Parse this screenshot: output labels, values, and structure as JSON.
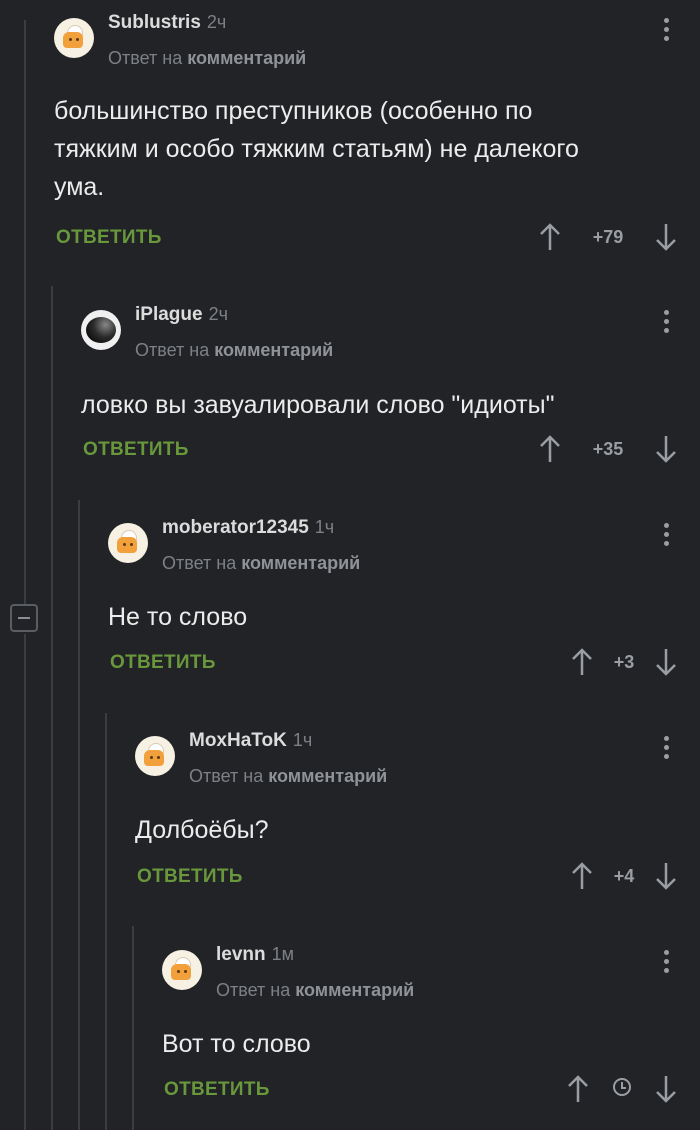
{
  "comments": [
    {
      "username": "Sublustris",
      "time": "2ч",
      "reply_prefix": "Ответ на",
      "reply_link": "комментарий",
      "text": "большинство преступников (особенно по тяжким и особо тяжким статьям) не далекого ума.",
      "reply_label": "ОТВЕТИТЬ",
      "score": "+79",
      "avatar_icon": "cook-avatar-icon"
    },
    {
      "username": "iPlague",
      "time": "2ч",
      "reply_prefix": "Ответ на",
      "reply_link": "комментарий",
      "text": "ловко вы завуалировали слово \"идиоты\"",
      "reply_label": "ОТВЕТИТЬ",
      "score": "+35",
      "avatar_icon": "dark-sphere-avatar-icon"
    },
    {
      "username": "moberator12345",
      "time": "1ч",
      "reply_prefix": "Ответ на",
      "reply_link": "комментарий",
      "text": "Не то слово",
      "reply_label": "ОТВЕТИТЬ",
      "score": "+3",
      "avatar_icon": "cook-avatar-icon"
    },
    {
      "username": "MoxHaToK",
      "time": "1ч",
      "reply_prefix": "Ответ на",
      "reply_link": "комментарий",
      "text": "Долбоёбы?",
      "reply_label": "ОТВЕТИТЬ",
      "score": "+4",
      "avatar_icon": "cook-avatar-icon"
    },
    {
      "username": "levnn",
      "time": "1м",
      "reply_prefix": "Ответ на",
      "reply_link": "комментарий",
      "text": "Вот то слово",
      "reply_label": "ОТВЕТИТЬ",
      "score": "",
      "score_icon": "clock-icon",
      "avatar_icon": "cook-avatar-icon"
    }
  ],
  "colors": {
    "background": "#212326",
    "reply_button": "#69973c",
    "thread_line": "#3a3d41",
    "muted_text": "#7d8085"
  },
  "icons": {
    "upvote": "arrow-up-icon",
    "downvote": "arrow-down-icon",
    "more": "more-vertical-icon",
    "collapse": "collapse-minus-icon"
  }
}
